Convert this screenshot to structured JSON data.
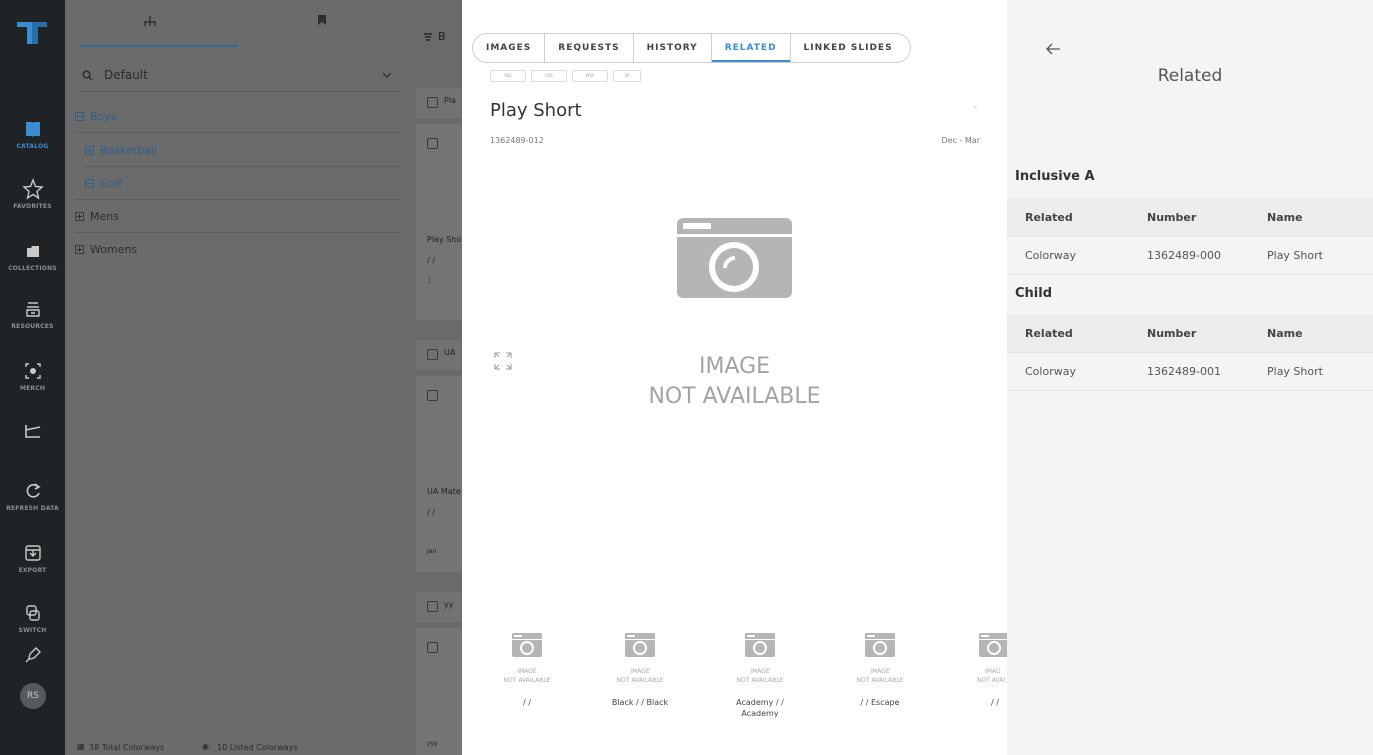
{
  "nav": {
    "items": [
      {
        "label": "CATALOG"
      },
      {
        "label": "FAVORITES"
      },
      {
        "label": "COLLECTIONS"
      },
      {
        "label": "RESOURCES"
      },
      {
        "label": "MERCH"
      },
      {
        "label": ""
      },
      {
        "label": "REFRESH DATA"
      },
      {
        "label": "EXPORT"
      },
      {
        "label": "SWITCH"
      },
      {
        "label": ""
      }
    ],
    "avatar": "RS"
  },
  "tree": {
    "search_value": "Default",
    "nodes": [
      {
        "label": "Boys"
      },
      {
        "label": "Basketball"
      },
      {
        "label": "Golf"
      },
      {
        "label": "Mens"
      },
      {
        "label": "Womens"
      }
    ],
    "footer_total": "38 Total Colorways",
    "footer_listed": "10 Listed Colorways"
  },
  "list": {
    "header_text": "B",
    "groups": [
      {
        "header": "Pla",
        "name": "Play Sho",
        "slash": "/ /",
        "meta": "1"
      },
      {
        "header": "UA",
        "name": "UA Mate",
        "slash": "/ /",
        "meta": "Jan"
      },
      {
        "header": "yy",
        "name": "",
        "slash": "",
        "meta": "yyy"
      }
    ]
  },
  "detail": {
    "tabs": [
      {
        "label": "IMAGES"
      },
      {
        "label": "REQUESTS"
      },
      {
        "label": "HISTORY"
      },
      {
        "label": "RELATED"
      },
      {
        "label": "LINKED SLIDES"
      }
    ],
    "active_tab": "RELATED",
    "mini_tabs": [
      "SKE",
      "FAB",
      "WSP",
      "SP"
    ],
    "title": "Play Short",
    "number": "1362489-012",
    "season": "Dec - Mar",
    "dot": "-",
    "image_na_line1": "IMAGE",
    "image_na_line2": "NOT AVAILABLE",
    "thumbs": [
      {
        "na1": "IMAGE",
        "na2": "NOT AVAILABLE",
        "label": "/ /"
      },
      {
        "na1": "IMAGE",
        "na2": "NOT AVAILABLE",
        "label": "Black / / Black"
      },
      {
        "na1": "IMAGE",
        "na2": "NOT AVAILABLE",
        "label": "Academy / / Academy"
      },
      {
        "na1": "IMAGE",
        "na2": "NOT AVAILABLE",
        "label": "/ / Escape"
      },
      {
        "na1": "IMAG",
        "na2": "NOT AVAI",
        "label": "/ /"
      }
    ]
  },
  "related": {
    "title": "Related",
    "sections": [
      {
        "title": "Inclusive A",
        "headers": {
          "related": "Related",
          "number": "Number",
          "name": "Name"
        },
        "rows": [
          {
            "related": "Colorway",
            "number": "1362489-000",
            "name": "Play Short"
          }
        ]
      },
      {
        "title": "Child",
        "headers": {
          "related": "Related",
          "number": "Number",
          "name": "Name"
        },
        "rows": [
          {
            "related": "Colorway",
            "number": "1362489-001",
            "name": "Play Short"
          }
        ]
      }
    ]
  },
  "colors": {
    "accent": "#3b8dd0",
    "rail": "#1f2326",
    "overlay": "#6b6b6b",
    "panel": "#f4f4f4"
  }
}
